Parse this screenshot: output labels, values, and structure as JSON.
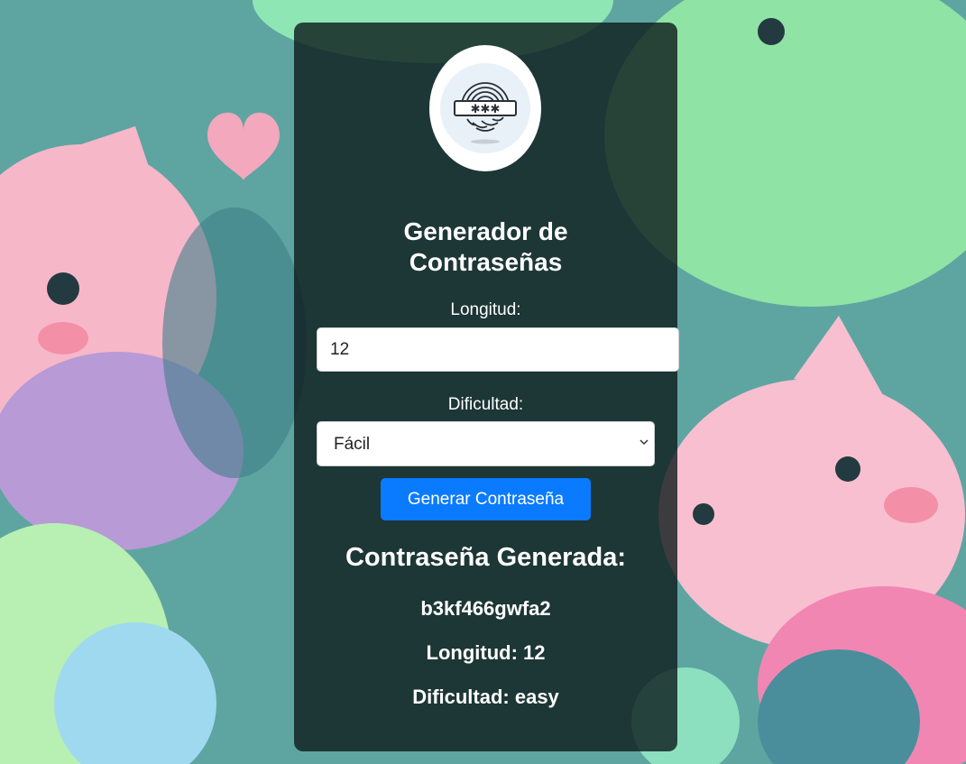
{
  "card": {
    "title_line1": "Generador de",
    "title_line2": "Contraseñas",
    "logo_icon": "fingerprint-password-icon"
  },
  "form": {
    "length_label": "Longitud:",
    "length_value": "12",
    "difficulty_label": "Dificultad:",
    "difficulty_selected": "Fácil",
    "generate_button": "Generar Contraseña"
  },
  "result": {
    "heading": "Contraseña Generada:",
    "password": "b3kf466gwfa2",
    "length_text": "Longitud: 12",
    "difficulty_text": "Dificultad: easy"
  },
  "colors": {
    "button": "#0a7bff",
    "card_overlay": "rgba(12, 26, 28, 0.80)"
  }
}
